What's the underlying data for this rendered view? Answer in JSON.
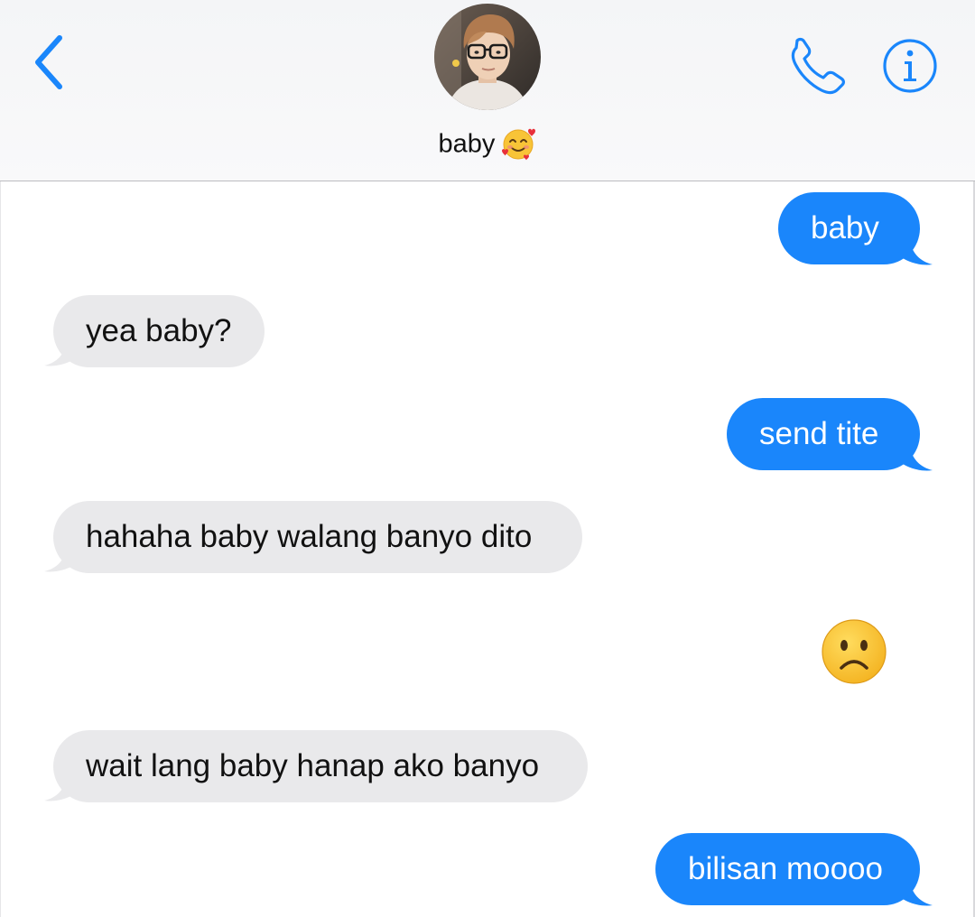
{
  "header": {
    "contact_name": "baby",
    "contact_emoji": "smiling-face-with-hearts",
    "back_icon": "chevron-left-icon",
    "call_icon": "phone-icon",
    "info_icon": "info-icon"
  },
  "messages": [
    {
      "direction": "sent",
      "text": "baby"
    },
    {
      "direction": "received",
      "text": "yea baby?"
    },
    {
      "direction": "sent",
      "text": "send tite"
    },
    {
      "direction": "received",
      "text": "hahaha baby walang banyo dito"
    },
    {
      "direction": "sent",
      "text": "",
      "emoji": "frowning-face"
    },
    {
      "direction": "received",
      "text": "wait lang baby hanap ako banyo"
    },
    {
      "direction": "sent",
      "text": "bilisan moooo"
    }
  ],
  "colors": {
    "accent": "#1a86fb",
    "sent_bubble": "#1a86fb",
    "received_bubble": "#e9e9eb",
    "header_bg": "#f6f6f8"
  }
}
